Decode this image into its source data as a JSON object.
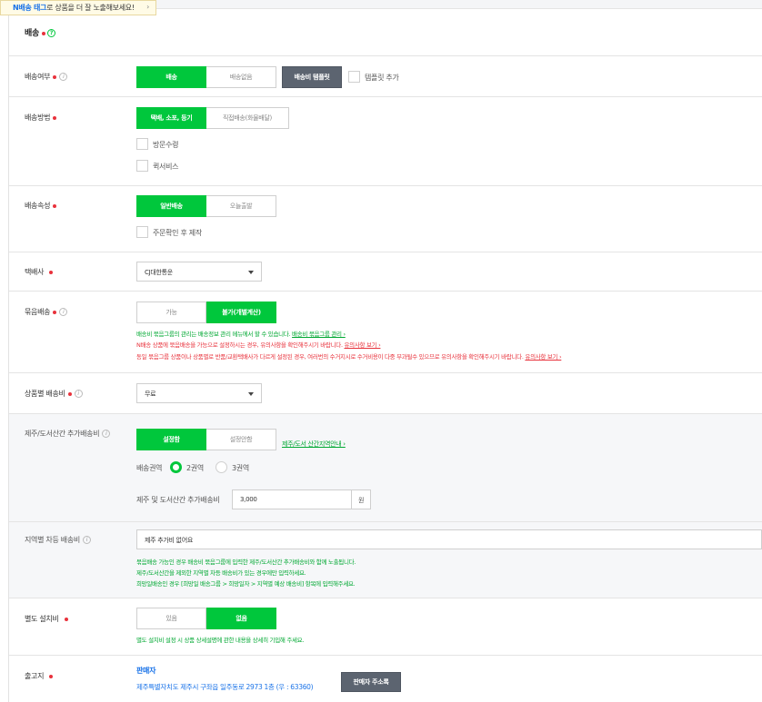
{
  "tooltip": {
    "highlight": "N배송 태그",
    "text": "로 상품을 더 잘 노출해보세요!",
    "chevron": "›"
  },
  "section": {
    "title": "배송",
    "help": "?"
  },
  "delivery_enabled": {
    "label": "배송여부",
    "info": "i",
    "options": [
      "배송",
      "배송없음"
    ],
    "selected": "배송",
    "template_button": "배송비 템플릿",
    "template_add": "템플릿 추가"
  },
  "delivery_method": {
    "label": "배송방법",
    "options": [
      "택배, 소포, 등기",
      "직접배송(화물배달)"
    ],
    "selected": "택배, 소포, 등기",
    "checkboxes": [
      "방문수령",
      "퀵서비스"
    ]
  },
  "delivery_attr": {
    "label": "배송속성",
    "options": [
      "일반배송",
      "오늘출발"
    ],
    "selected": "일반배송",
    "checkbox": "주문확인 후 제작"
  },
  "courier": {
    "label": "택배사",
    "value": "CJ대한통운"
  },
  "bundle": {
    "label": "묶음배송",
    "info": "i",
    "options": [
      "가능",
      "불가(개별계산)"
    ],
    "selected": "불가(개별계산)",
    "notes": [
      {
        "text": "배송비 묶음그룹의 관리는 배송정보 관리 메뉴에서 할 수 있습니다.",
        "link": "배송비 묶음그룹 관리 ›"
      },
      {
        "text": "N배송 상품에 묶음배송을 가능으로 설정하시는 경우, 유의사항을 확인해주시기 바랍니다.",
        "link": "유의사항 보기 ›"
      },
      {
        "text": "동일 묶음그룹 상품이나 상품별로 반품/교환택배사가 다르게 설정된 경우, 여러번의 수거지시로 수거비용이 다중 부과될수 있으므로 유의사항을 확인해주시기 바랍니다.",
        "link": "유의사항 보기 ›"
      }
    ]
  },
  "fee": {
    "label": "상품별 배송비",
    "info": "i",
    "value": "무료"
  },
  "jeju": {
    "label": "제주/도서산간 추가배송비",
    "info": "i",
    "options": [
      "설정함",
      "설정안함"
    ],
    "selected": "설정함",
    "guide_link": "제주/도서 산간지역안내 ›",
    "area_label": "배송권역",
    "areas": [
      "2권역",
      "3권역"
    ],
    "area_selected": "2권역",
    "extra_label": "제주 및 도서산간 추가배송비",
    "extra_value": "3,000",
    "unit": "원"
  },
  "regional": {
    "label": "지역별 차등 배송비",
    "info": "i",
    "value": "제주 추가비 없어요",
    "notes": [
      "묶음배송 가능인 경우 배송비 묶음그룹에 입력한 제주/도서산간 추가배송비와 함께 노출됩니다.",
      "제주/도서산간을 제외한 지역별 차등 배송비가 있는 경우에만 입력하세요.",
      "희망일배송인 경우 [희망일 배송그룹 > 희망일자 > 지역별 예상 배송비] 항목에 입력해주세요."
    ]
  },
  "install": {
    "label": "별도 설치비",
    "options": [
      "있음",
      "없음"
    ],
    "selected": "없음",
    "note": "별도 설치비 설정 시 상품 상세설명에 관한 내용을 상세히 기입해 주세요."
  },
  "origin": {
    "label": "출고지",
    "seller": "판매자",
    "address": "제주특별자치도 제주시 구좌읍 일주동로 2973 1층 (우 : 63360)",
    "button": "판매자 주소록"
  },
  "colors": {
    "accent": "#00c73c",
    "required": "#e8323c",
    "link": "#1a73e8",
    "dark_button": "#5c6470"
  }
}
